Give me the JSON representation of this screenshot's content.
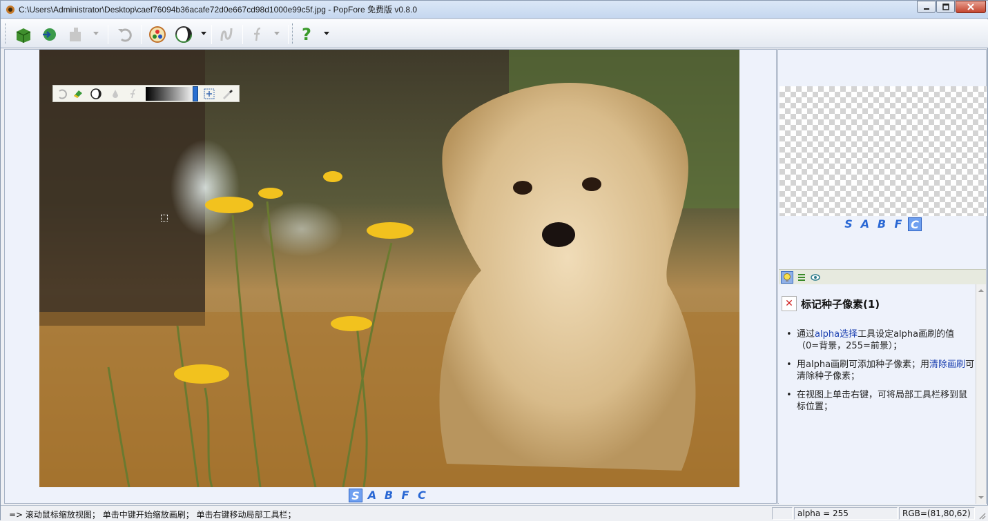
{
  "window": {
    "title": "C:\\Users\\Administrator\\Desktop\\caef76094b36acafe72d0e667cd98d1000e99c5f.jpg - PopFore 免费版 v0.8.0",
    "minimize_glyph": "▁",
    "maximize_glyph": "▢",
    "close_glyph": "✕"
  },
  "toolbar": {
    "help_glyph": "?"
  },
  "view_tabs": {
    "items": [
      "S",
      "A",
      "B",
      "F",
      "C"
    ],
    "left_active": "S",
    "right_active": "C"
  },
  "help_panel": {
    "title": "标记种子像素(1)",
    "close_glyph": "✕",
    "items": [
      {
        "parts": [
          "通过",
          "alpha选择",
          "工具设定alpha画刷的值（0=背景，255=前景）；"
        ]
      },
      {
        "parts": [
          "用alpha画刷可添加种子像素；用",
          "清除画刷",
          "可清除种子像素；"
        ]
      },
      {
        "parts": [
          "在视图上单击右键，可将局部工具栏移到鼠标位置；"
        ]
      }
    ]
  },
  "status": {
    "message": "=> 滚动鼠标缩放视图； 单击中键开始缩放画刷； 单击右键移动局部工具栏；",
    "alpha": "alpha = 255",
    "rgb": "RGB=(81,80,62)"
  },
  "colors": {
    "accent": "#2a68d4",
    "active_tab": "#6fa0f0",
    "link": "#1a3fb0"
  }
}
